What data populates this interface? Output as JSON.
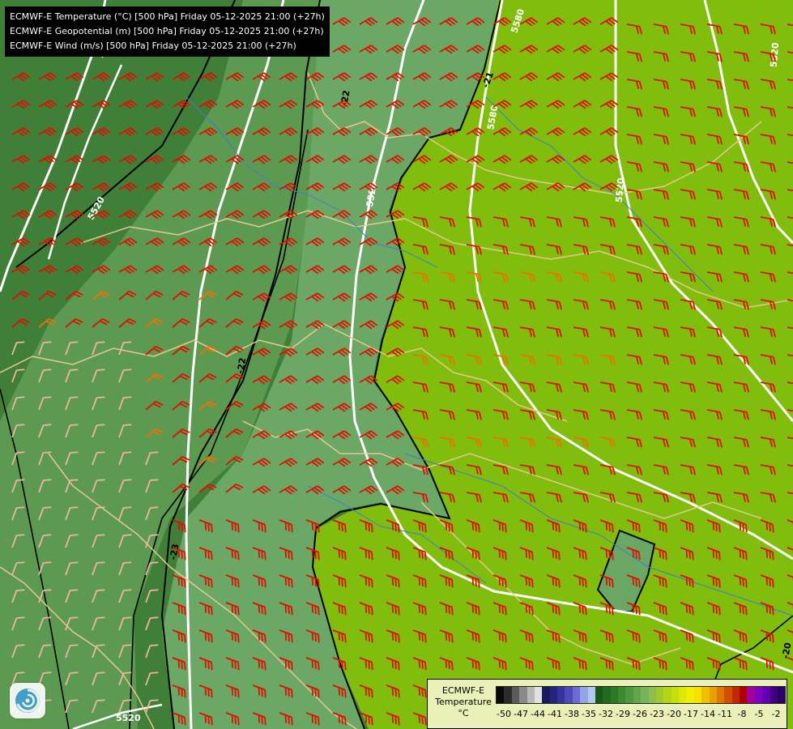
{
  "header": {
    "lines": [
      "ECMWF-E Temperature (°C) [500 hPa] Friday 05-12-2025 21:00 (+27h)",
      "ECMWF-E Geopotential (m) [500 hPa] Friday 05-12-2025 21:00 (+27h)",
      "ECMWF-E Wind (m/s) [500 hPa] Friday 05-12-2025 21:00 (+27h)"
    ]
  },
  "legend": {
    "title": [
      "ECMWF-E",
      "Temperature",
      "°C"
    ],
    "ticks": [
      "-50",
      "-47",
      "-44",
      "-41",
      "-38",
      "-35",
      "-32",
      "-29",
      "-26",
      "-23",
      "-20",
      "-17",
      "-14",
      "-11",
      "-8",
      "-5",
      "-2"
    ],
    "colors": [
      "#0a0a0a",
      "#2c2c2c",
      "#5a5a5a",
      "#8a8a8a",
      "#b8b8b8",
      "#e2e2e2",
      "#1a1a5e",
      "#25257f",
      "#34349c",
      "#4a4ab8",
      "#6b6bd3",
      "#8fa6e3",
      "#b4c8ee",
      "#145a14",
      "#1f6a1f",
      "#2c7a28",
      "#3a8a32",
      "#4e983f",
      "#62a64c",
      "#78b25a",
      "#8cbe4a",
      "#9fca2a",
      "#b4d418",
      "#c8de10",
      "#dce808",
      "#eef000",
      "#f8e000",
      "#f0c000",
      "#e8a000",
      "#e07800",
      "#d05000",
      "#c02800",
      "#b00000",
      "#a000a0",
      "#8000c0",
      "#6000b0",
      "#40007f",
      "#2a0060"
    ]
  },
  "contours": {
    "geopotential_labels": [
      "5580",
      "5520",
      "5520",
      "5520",
      "5520",
      "5520",
      "5580",
      "5520",
      "5520"
    ],
    "temperature_labels": [
      "-22",
      "-21",
      "-22",
      "-20",
      "-23"
    ]
  },
  "zones": {
    "cold_dark": "#3f7f37",
    "mid": "#5d9b54",
    "light": "#6aa764",
    "warm": "#80bd0c"
  },
  "logo_icon": "ecmwf-swirl-icon"
}
